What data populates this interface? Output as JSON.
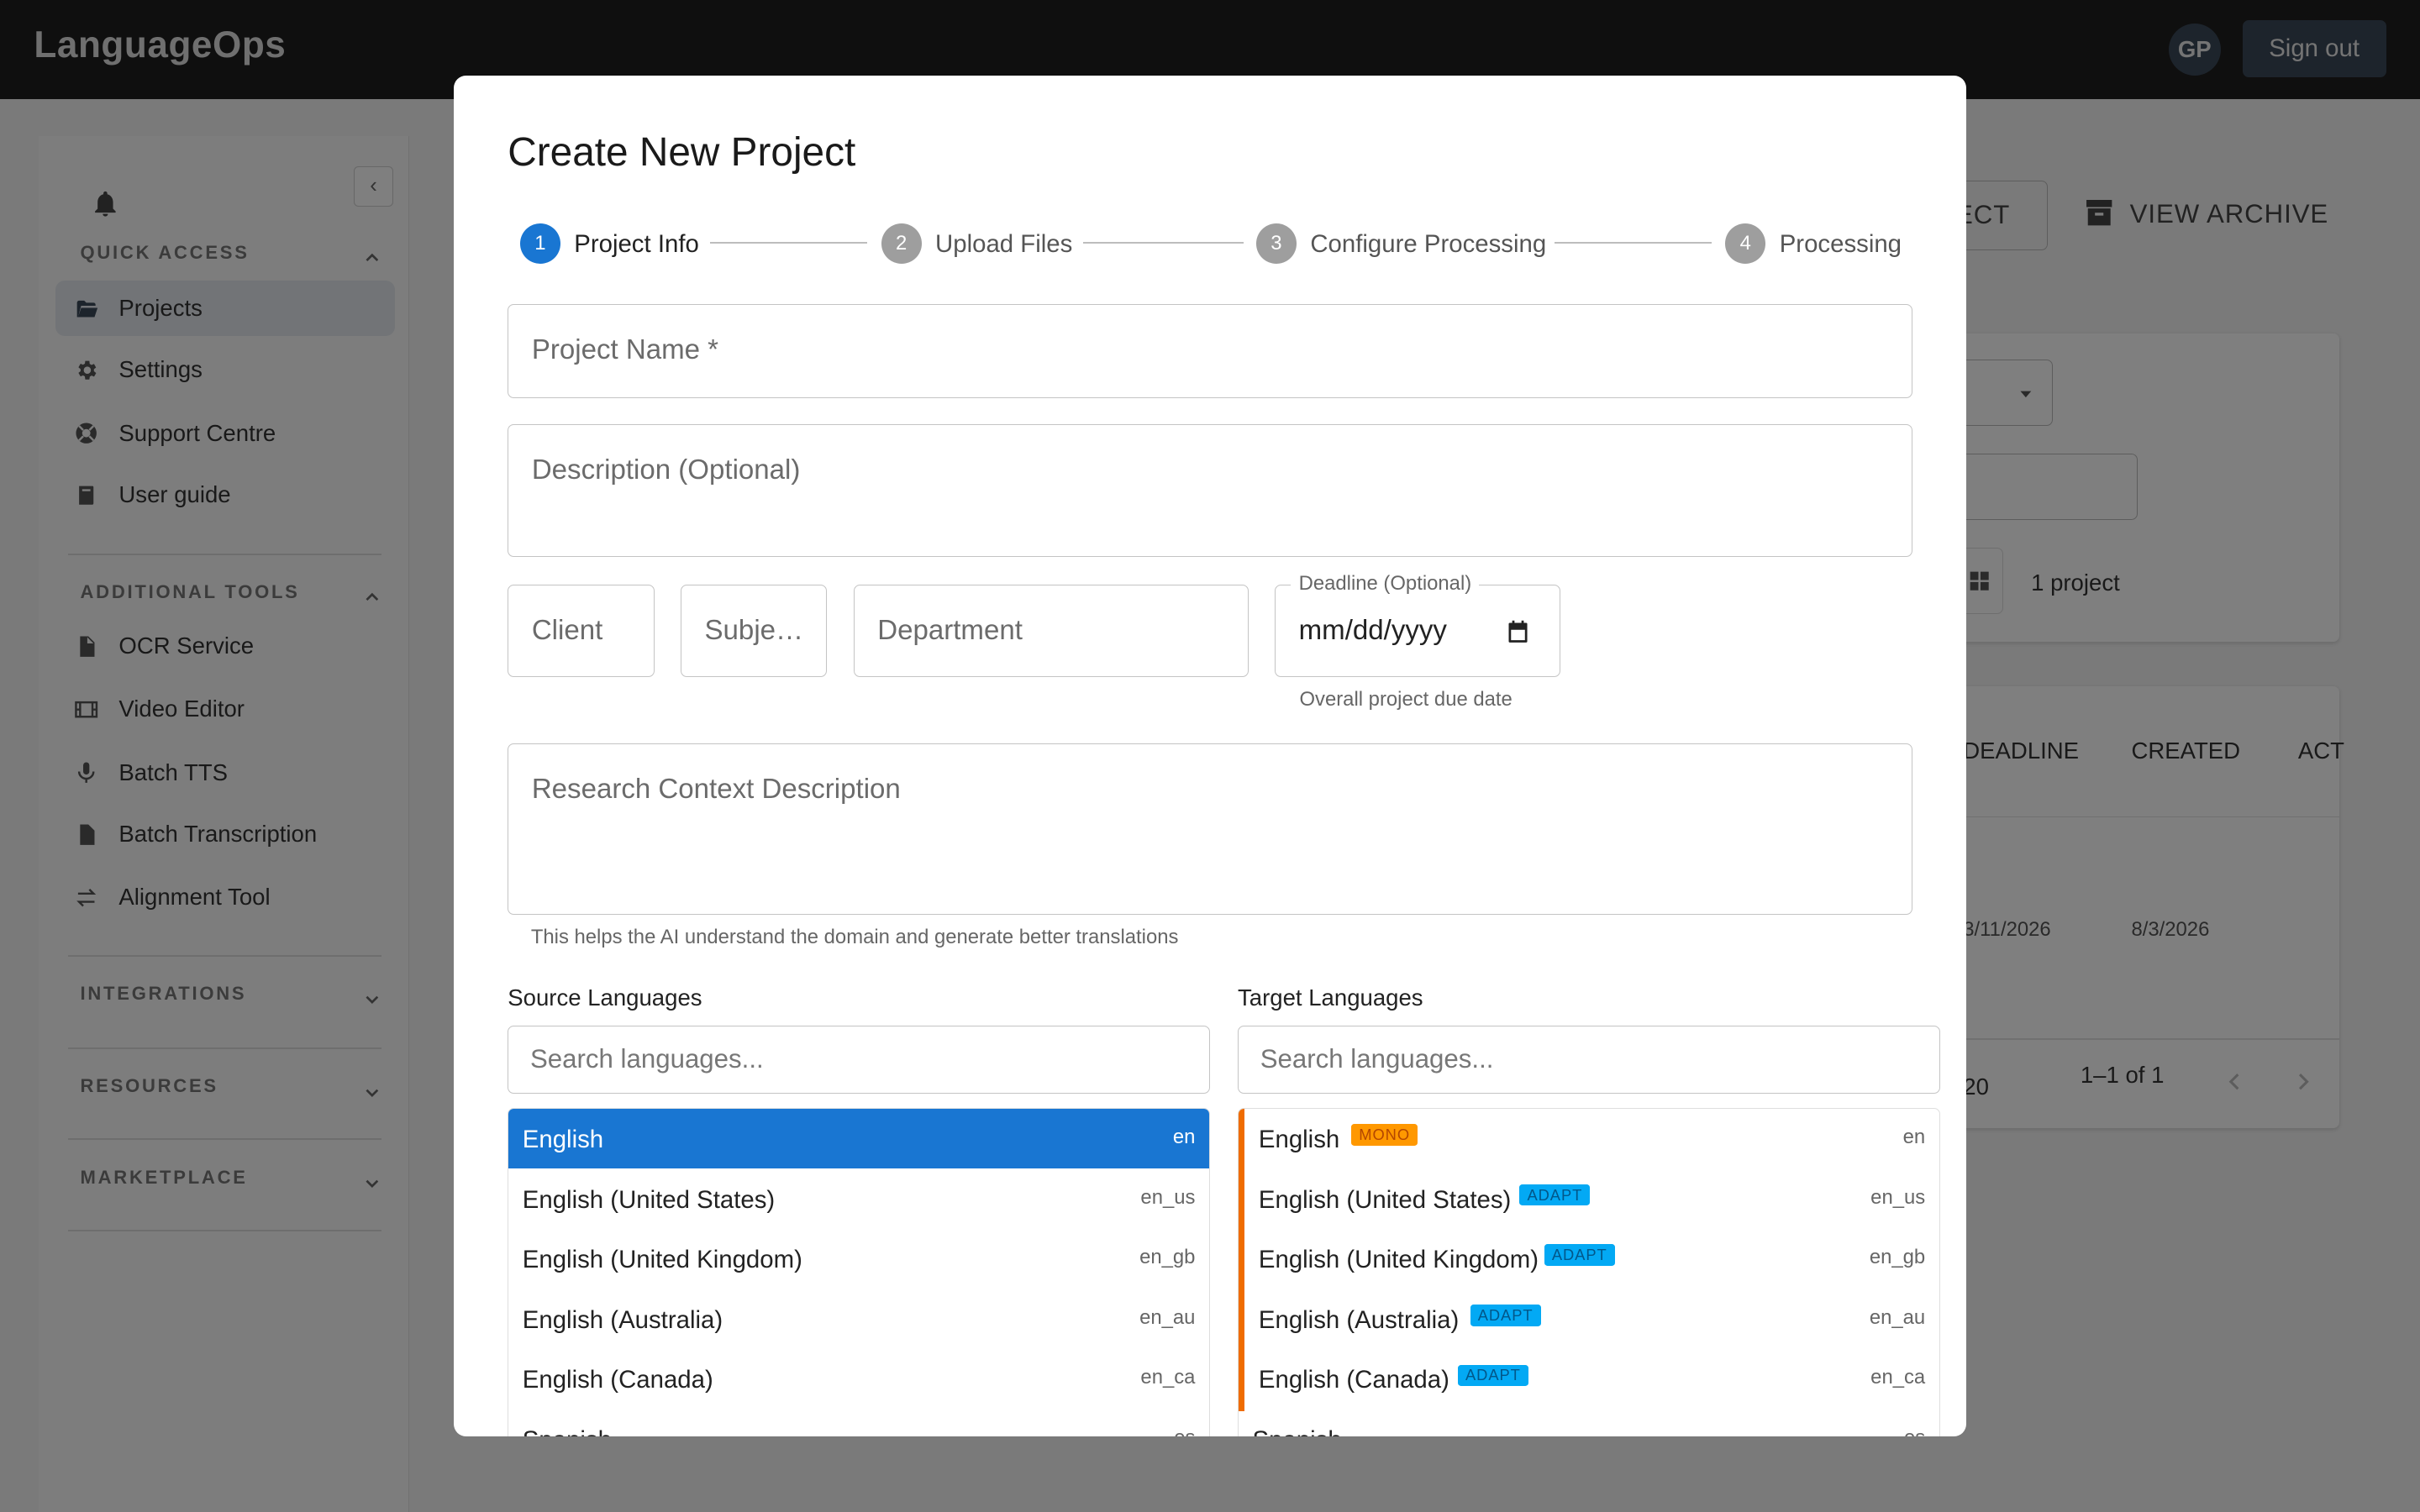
{
  "app": {
    "brand": "LanguageOps",
    "avatar_initials": "GP",
    "signout_label": "Sign out"
  },
  "sidebar": {
    "quick_access_title": "QUICK ACCESS",
    "quick_items": [
      {
        "label": "Projects",
        "icon": "folder-icon"
      },
      {
        "label": "Settings",
        "icon": "gear-icon"
      },
      {
        "label": "Support Centre",
        "icon": "support-icon"
      },
      {
        "label": "User guide",
        "icon": "book-icon"
      }
    ],
    "additional_tools_title": "ADDITIONAL TOOLS",
    "tool_items": [
      {
        "label": "OCR Service",
        "icon": "document-icon"
      },
      {
        "label": "Video Editor",
        "icon": "film-icon"
      },
      {
        "label": "Batch TTS",
        "icon": "mic-icon"
      },
      {
        "label": "Batch Transcription",
        "icon": "document-icon"
      },
      {
        "label": "Alignment Tool",
        "icon": "swap-icon"
      }
    ],
    "integrations_title": "INTEGRATIONS",
    "resources_title": "RESOURCES",
    "marketplace_title": "MARKETPLACE"
  },
  "background": {
    "new_project_btn": "ECT",
    "view_archive_btn": "VIEW ARCHIVE",
    "project_count": "1 project",
    "col_deadline": "DEADLINE",
    "col_created": "CREATED",
    "col_actions": "ACT",
    "row_deadline": "3/11/2026",
    "row_created": "8/3/2026",
    "rows_per_page": "20",
    "pagination": "1–1 of 1"
  },
  "modal": {
    "title": "Create New Project",
    "steps": [
      {
        "num": "1",
        "label": "Project Info",
        "active": true
      },
      {
        "num": "2",
        "label": "Upload Files",
        "active": false
      },
      {
        "num": "3",
        "label": "Configure Processing",
        "active": false
      },
      {
        "num": "4",
        "label": "Processing",
        "active": false
      }
    ],
    "project_name_placeholder": "Project Name *",
    "description_placeholder": "Description (Optional)",
    "client_placeholder": "Client",
    "subject_placeholder": "Subje…",
    "department_placeholder": "Department",
    "deadline_label": "Deadline (Optional)",
    "deadline_value": "mm/dd/yyyy",
    "deadline_helper": "Overall project due date",
    "research_placeholder": "Research Context Description",
    "research_helper": "This helps the AI understand the domain and generate better translations",
    "source": {
      "title": "Source Languages",
      "search_placeholder": "Search languages...",
      "items": [
        {
          "name": "English",
          "code": "en"
        },
        {
          "name": "English (United States)",
          "code": "en_us"
        },
        {
          "name": "English (United Kingdom)",
          "code": "en_gb"
        },
        {
          "name": "English (Australia)",
          "code": "en_au"
        },
        {
          "name": "English (Canada)",
          "code": "en_ca"
        },
        {
          "name": "Spanish",
          "code": "es"
        }
      ]
    },
    "target": {
      "title": "Target Languages",
      "search_placeholder": "Search languages...",
      "items": [
        {
          "name": "English",
          "code": "en",
          "badge": "MONO"
        },
        {
          "name": "English (United States)",
          "code": "en_us",
          "badge": "ADAPT"
        },
        {
          "name": "English (United Kingdom)",
          "code": "en_gb",
          "badge": "ADAPT"
        },
        {
          "name": "English (Australia)",
          "code": "en_au",
          "badge": "ADAPT"
        },
        {
          "name": "English (Canada)",
          "code": "en_ca",
          "badge": "ADAPT"
        },
        {
          "name": "Spanish",
          "code": "es",
          "badge": ""
        }
      ]
    }
  },
  "colors": {
    "accent": "#1976d2",
    "mono_badge": "#ff9800",
    "adapt_badge": "#03a9f4",
    "target_bar": "#ef6c00",
    "topbar": "#1e1e1e"
  }
}
